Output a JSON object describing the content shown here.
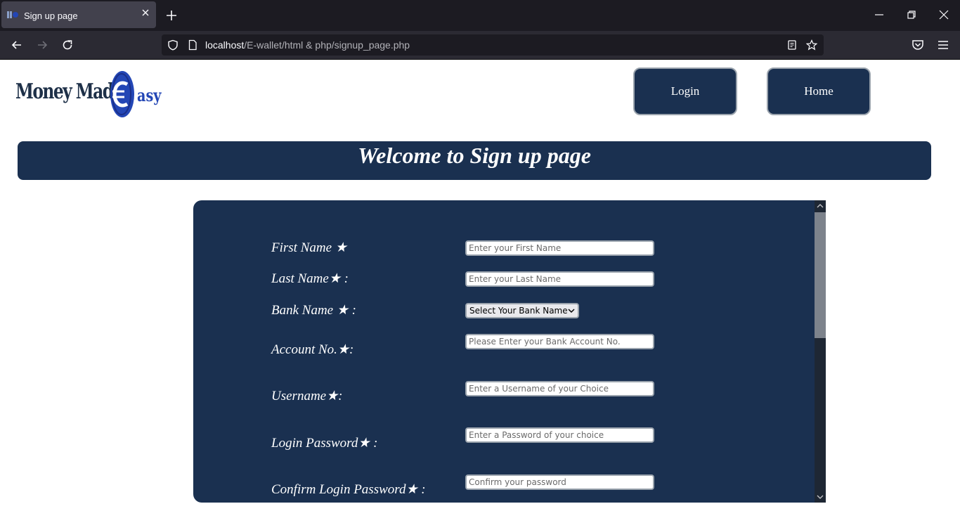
{
  "browser": {
    "tab_title": "Sign up page",
    "url_host": "localhost",
    "url_path": "/E-wallet/html & php/signup_page.php"
  },
  "header": {
    "logo_text": "Money Made",
    "logo_tail": "asy",
    "login_label": "Login",
    "home_label": "Home"
  },
  "banner": {
    "title": "Welcome to Sign up page"
  },
  "form": {
    "first_name": {
      "label": "First Name ★",
      "placeholder": "Enter your First Name"
    },
    "last_name": {
      "label": "Last Name★ :",
      "placeholder": "Enter your Last Name"
    },
    "bank_name": {
      "label": "Bank Name ★ :",
      "selected": "Select Your Bank Name"
    },
    "account_no": {
      "label": "Account No.★:",
      "placeholder": "Please Enter your Bank Account No."
    },
    "username": {
      "label": "Username★:",
      "placeholder": "Enter a Username of your Choice"
    },
    "login_password": {
      "label": "Login Password★ :",
      "placeholder": "Enter a Password of your choice"
    },
    "confirm_password": {
      "label": "Confirm Login Password★ :",
      "placeholder": "Confirm your password"
    }
  },
  "colors": {
    "brand_navy": "#1a3050",
    "logo_blue": "#2346b5"
  }
}
